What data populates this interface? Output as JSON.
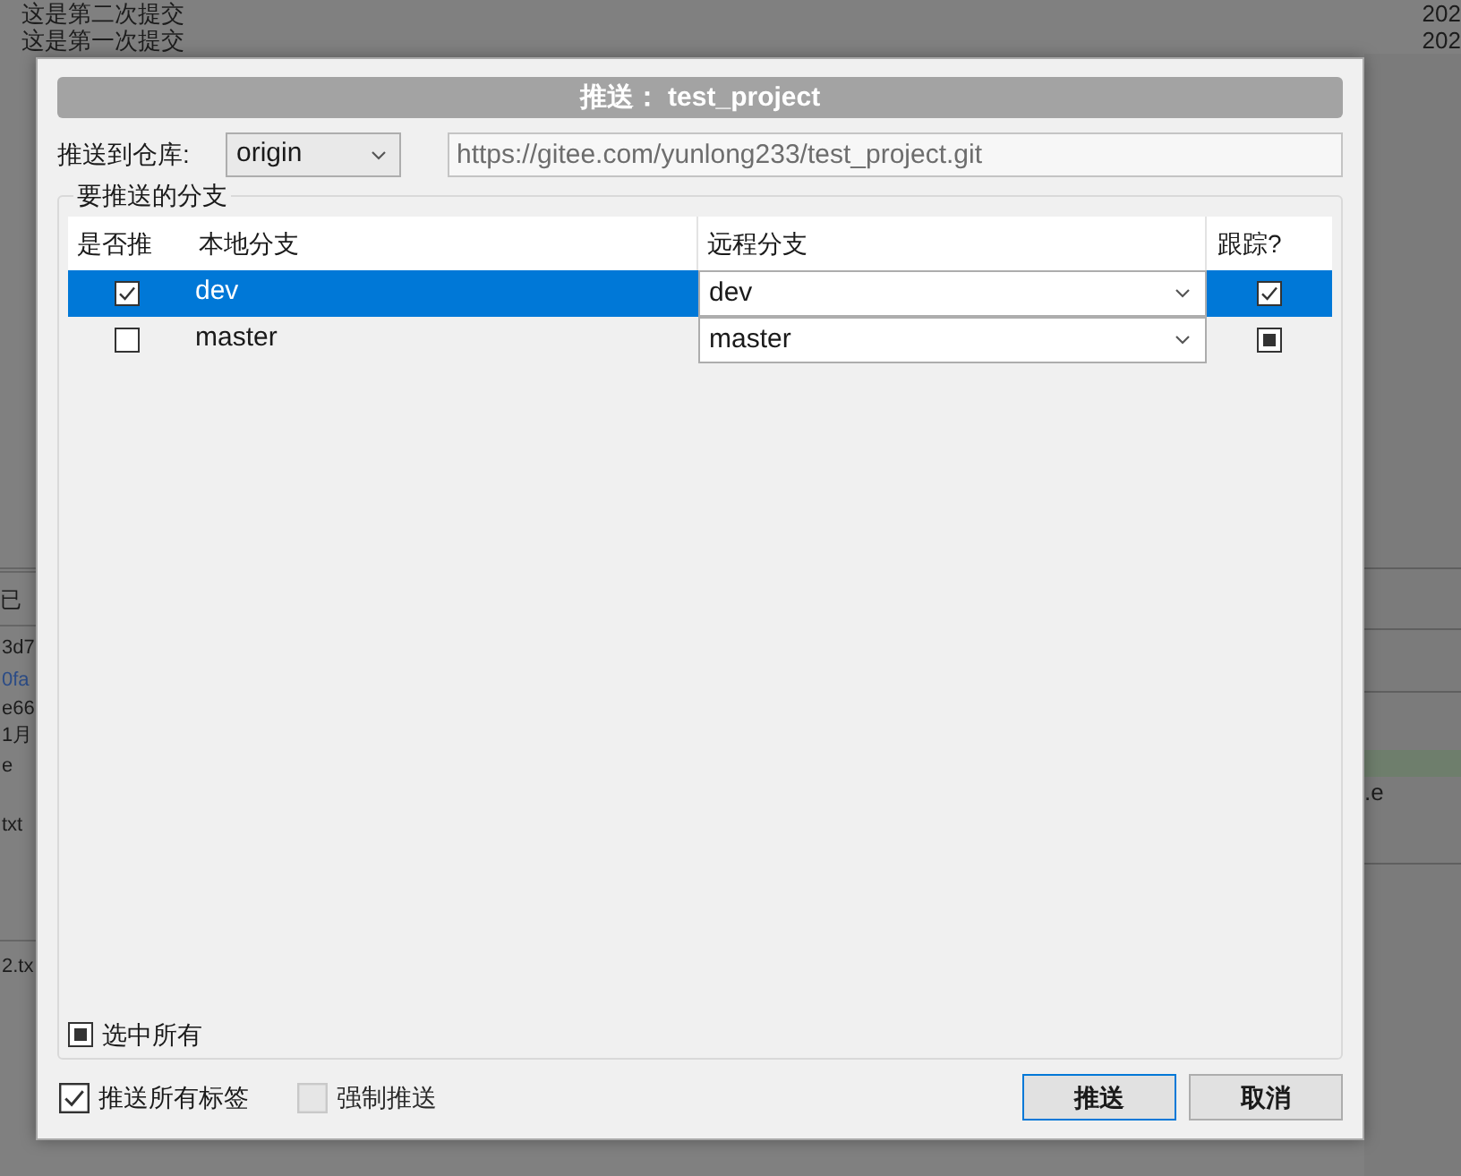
{
  "background": {
    "commits": [
      {
        "message": "这是第二次提交",
        "date": "202"
      },
      {
        "message": "这是第一次提交",
        "date": "202"
      }
    ],
    "left_panel": {
      "header": "已",
      "lines": [
        {
          "text": "3d7",
          "kind": "text"
        },
        {
          "text": "0fa",
          "kind": "link"
        },
        {
          "text": "e66",
          "kind": "text"
        },
        {
          "text": "1月",
          "kind": "text"
        },
        {
          "text": "e",
          "kind": "text"
        },
        {
          "text": "txt",
          "kind": "text"
        }
      ],
      "footer": "2.tx"
    },
    "right_panel": {
      "text": ".e"
    }
  },
  "dialog": {
    "title": "推送： test_project",
    "repository_label": "推送到仓库:",
    "repository": "origin",
    "url": "https://gitee.com/yunlong233/test_project.git",
    "group_title": "要推送的分支",
    "columns": [
      "是否推",
      "本地分支",
      "远程分支",
      "跟踪?"
    ],
    "rows": [
      {
        "selected": true,
        "push": true,
        "branch": "dev",
        "remote": "dev",
        "track_checked": true,
        "track_partial": false
      },
      {
        "selected": false,
        "push": false,
        "branch": "master",
        "remote": "master",
        "track_checked": false,
        "track_partial": true
      }
    ],
    "select_all": {
      "label": "选中所有",
      "checked": false,
      "partial": true
    },
    "options": [
      {
        "label": "推送所有标签",
        "checked": true,
        "disabled": false
      },
      {
        "label": "强制推送",
        "checked": false,
        "disabled": true
      }
    ],
    "buttons": [
      {
        "label": "推送",
        "default": true
      },
      {
        "label": "取消",
        "default": false
      }
    ]
  }
}
